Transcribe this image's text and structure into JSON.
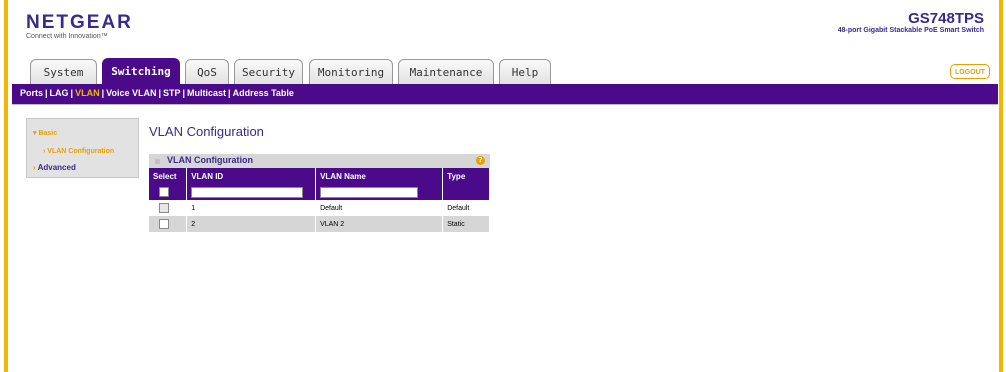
{
  "header": {
    "logo": "NETGEAR",
    "tagline": "Connect with Innovation™",
    "model": "GS748TPS",
    "model_description": "48-port Gigabit Stackable PoE Smart Switch",
    "logout_label": "LOGOUT"
  },
  "tabs": [
    {
      "label": "System"
    },
    {
      "label": "Switching",
      "active": true
    },
    {
      "label": "QoS"
    },
    {
      "label": "Security"
    },
    {
      "label": "Monitoring"
    },
    {
      "label": "Maintenance"
    },
    {
      "label": "Help"
    }
  ],
  "subnav": {
    "ports": "Ports",
    "lag": "LAG",
    "vlan": "VLAN",
    "voice_vlan": "Voice VLAN",
    "stp": "STP",
    "multicast": "Multicast",
    "address_table": "Address Table",
    "separator": "|"
  },
  "sidemenu": {
    "basic": "Basic",
    "vlan_configuration": "VLAN Configuration",
    "advanced": "Advanced"
  },
  "page_title": "VLAN Configuration",
  "panel": {
    "title": "VLAN Configuration",
    "help": "?",
    "columns": [
      "Select",
      "VLAN ID",
      "VLAN Name",
      "Type"
    ],
    "edit_row": {
      "vlan_id": "",
      "vlan_name": ""
    },
    "rows": [
      {
        "vlan_id": "1",
        "vlan_name": "Default",
        "type": "Default"
      },
      {
        "vlan_id": "2",
        "vlan_name": "VLAN 2",
        "type": "Static"
      }
    ]
  },
  "colors": {
    "brand_purple": "#4b0a8a",
    "accent_orange": "#e8a200",
    "frame_yellow": "#f0b800"
  }
}
